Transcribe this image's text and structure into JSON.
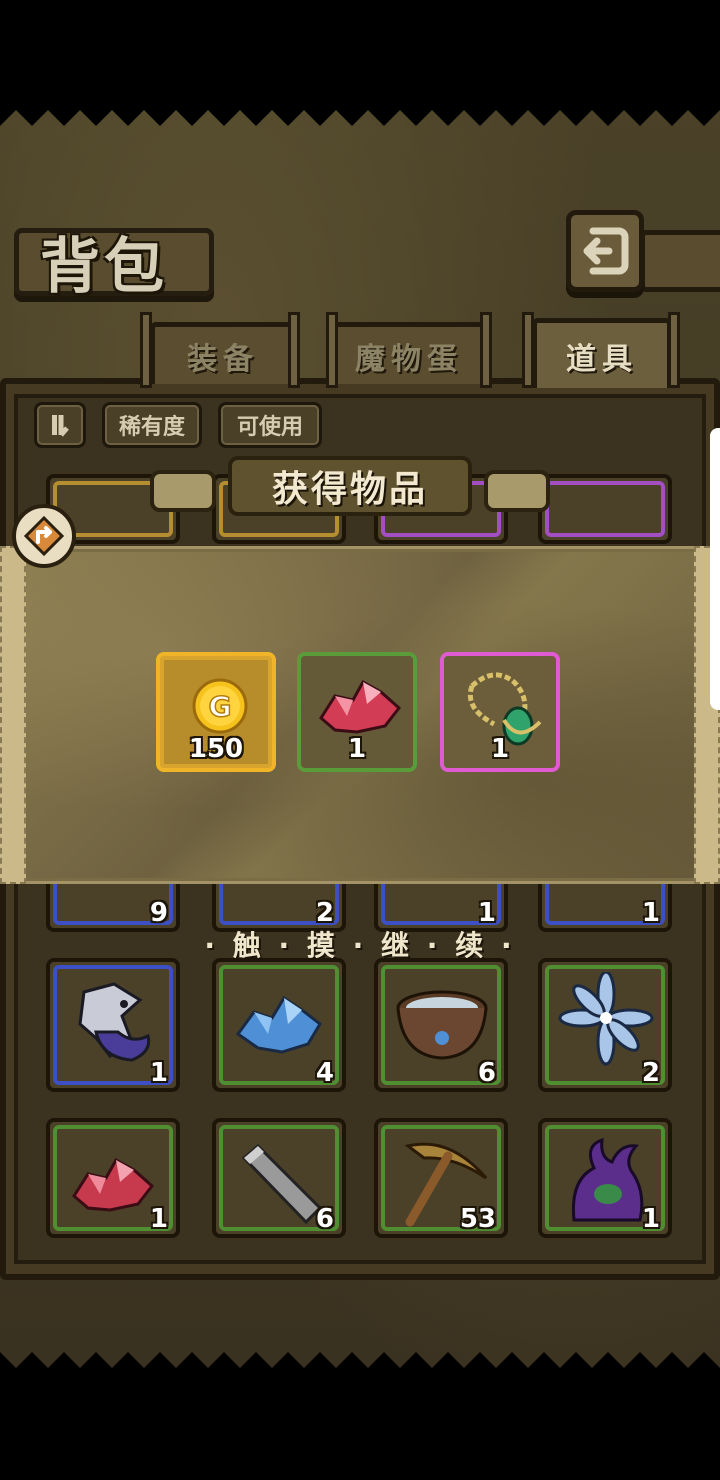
{
  "header": {
    "title": "背包",
    "back_icon": "return-arrow-icon"
  },
  "tabs": [
    {
      "label": "装备",
      "active": false
    },
    {
      "label": "魔物蛋",
      "active": false
    },
    {
      "label": "道具",
      "active": true
    }
  ],
  "filters": {
    "sort_icon": "sort-toggle-icon",
    "rarity_label": "稀有度",
    "usable_label": "可使用"
  },
  "modal": {
    "title": "获得物品",
    "rewards": [
      {
        "icon": "gold-coin-icon",
        "count": "150",
        "rarity": "gold"
      },
      {
        "icon": "red-crystal-icon",
        "count": "1",
        "rarity": "green"
      },
      {
        "icon": "jade-necklace-icon",
        "count": "1",
        "rarity": "pink"
      }
    ]
  },
  "hint": "· 触 · 摸 · 继 · 续 ·",
  "inventory": {
    "row_partial": [
      {
        "count": "9",
        "rarity": "blue"
      },
      {
        "count": "2",
        "rarity": "blue"
      },
      {
        "count": "1",
        "rarity": "blue"
      },
      {
        "count": "1",
        "rarity": "blue"
      }
    ],
    "row2": [
      {
        "icon": "spirit-creature-icon",
        "count": "1",
        "rarity": "blue"
      },
      {
        "icon": "blue-crystal-icon",
        "count": "4",
        "rarity": "green"
      },
      {
        "icon": "water-bowl-icon",
        "count": "6",
        "rarity": "green"
      },
      {
        "icon": "blue-flower-icon",
        "count": "2",
        "rarity": "green"
      }
    ],
    "row3": [
      {
        "icon": "red-crystal-icon",
        "count": "1",
        "rarity": "green"
      },
      {
        "icon": "stone-bar-icon",
        "count": "6",
        "rarity": "green"
      },
      {
        "icon": "pickaxe-icon",
        "count": "53",
        "rarity": "green"
      },
      {
        "icon": "purple-plant-monster-icon",
        "count": "1",
        "rarity": "green"
      }
    ]
  }
}
